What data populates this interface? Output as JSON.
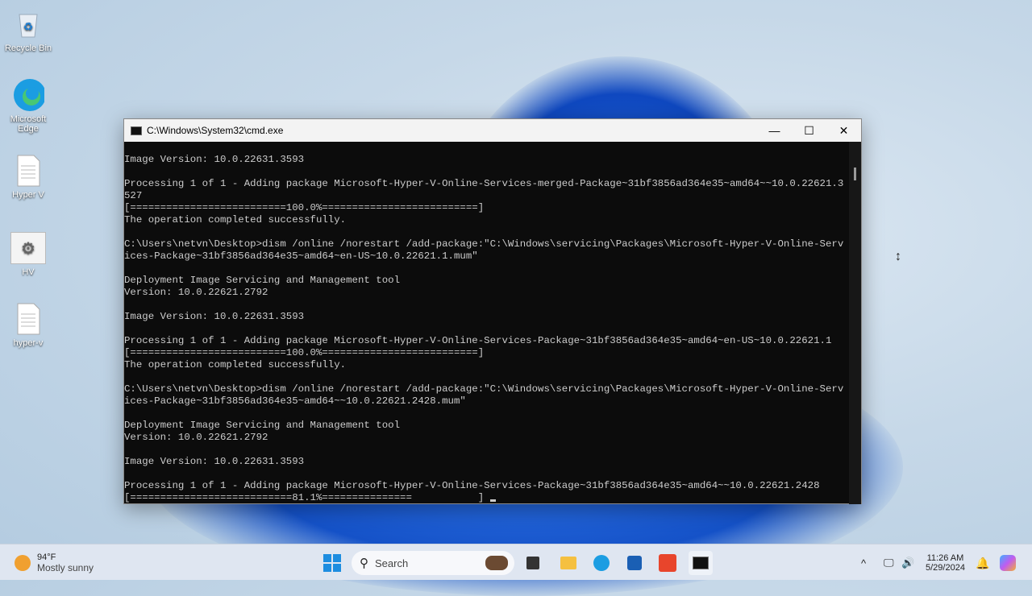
{
  "desktop": {
    "icons": [
      {
        "label": "Recycle Bin"
      },
      {
        "label": "Microsoft Edge"
      },
      {
        "label": "Hyper V"
      },
      {
        "label": "HV"
      },
      {
        "label": "hyper-v"
      }
    ]
  },
  "window": {
    "title": "C:\\Windows\\System32\\cmd.exe",
    "minimize": "—",
    "maximize": "☐",
    "close": "✕"
  },
  "console": {
    "lines": [
      "Image Version: 10.0.22631.3593",
      "",
      "Processing 1 of 1 - Adding package Microsoft-Hyper-V-Online-Services-merged-Package~31bf3856ad364e35~amd64~~10.0.22621.3",
      "527",
      "[==========================100.0%==========================]",
      "The operation completed successfully.",
      "",
      "C:\\Users\\netvn\\Desktop>dism /online /norestart /add-package:\"C:\\Windows\\servicing\\Packages\\Microsoft-Hyper-V-Online-Serv",
      "ices-Package~31bf3856ad364e35~amd64~en-US~10.0.22621.1.mum\"",
      "",
      "Deployment Image Servicing and Management tool",
      "Version: 10.0.22621.2792",
      "",
      "Image Version: 10.0.22631.3593",
      "",
      "Processing 1 of 1 - Adding package Microsoft-Hyper-V-Online-Services-Package~31bf3856ad364e35~amd64~en-US~10.0.22621.1",
      "[==========================100.0%==========================]",
      "The operation completed successfully.",
      "",
      "C:\\Users\\netvn\\Desktop>dism /online /norestart /add-package:\"C:\\Windows\\servicing\\Packages\\Microsoft-Hyper-V-Online-Serv",
      "ices-Package~31bf3856ad364e35~amd64~~10.0.22621.2428.mum\"",
      "",
      "Deployment Image Servicing and Management tool",
      "Version: 10.0.22621.2792",
      "",
      "Image Version: 10.0.22631.3593",
      "",
      "Processing 1 of 1 - Adding package Microsoft-Hyper-V-Online-Services-Package~31bf3856ad364e35~amd64~~10.0.22621.2428",
      "[===========================81.1%===============           ] "
    ],
    "progress_percent": 81.1
  },
  "taskbar": {
    "weather_temp": "94°F",
    "weather_desc": "Mostly sunny",
    "search_placeholder": "Search",
    "time": "11:26 AM",
    "date": "5/29/2024"
  }
}
